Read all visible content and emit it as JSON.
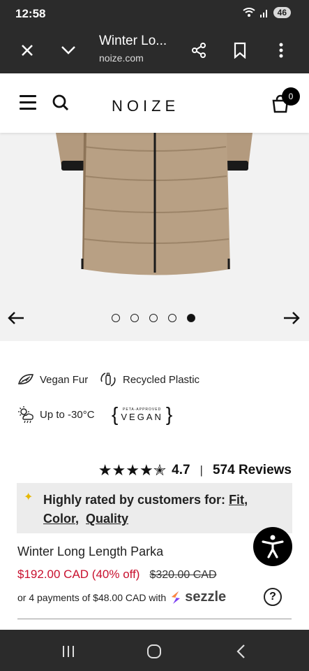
{
  "status_bar": {
    "time": "12:58",
    "battery": "46"
  },
  "browser": {
    "title": "Winter Lo...",
    "url": "noize.com"
  },
  "site": {
    "logo": "NOIZE",
    "cart_count": "0"
  },
  "gallery": {
    "slide_count": 5,
    "active_slide": 5
  },
  "features": {
    "vegan_fur": "Vegan Fur",
    "recycled": "Recycled Plastic",
    "temp": "Up to -30°C",
    "badge_small": "PETA-APPROVED",
    "badge_big": "VEGAN"
  },
  "rating": {
    "stars": "★★★★✭",
    "value": "4.7",
    "separator": "|",
    "reviews": "574 Reviews"
  },
  "rated_box": {
    "lead": "Highly rated by customers for: ",
    "fit": "Fit",
    "color": "Color",
    "quality": "Quality"
  },
  "product": {
    "name": "Winter Long Length Parka",
    "sale_price": "$192.00 CAD (40% off)",
    "original_price": "$320.00 CAD",
    "installments": "or 4 payments of $48.00 CAD with",
    "sezzle": "sezzle"
  },
  "colors": {
    "sale": "#c8102e",
    "bars": "#2b2b2b",
    "coat": "#b39a7e"
  }
}
